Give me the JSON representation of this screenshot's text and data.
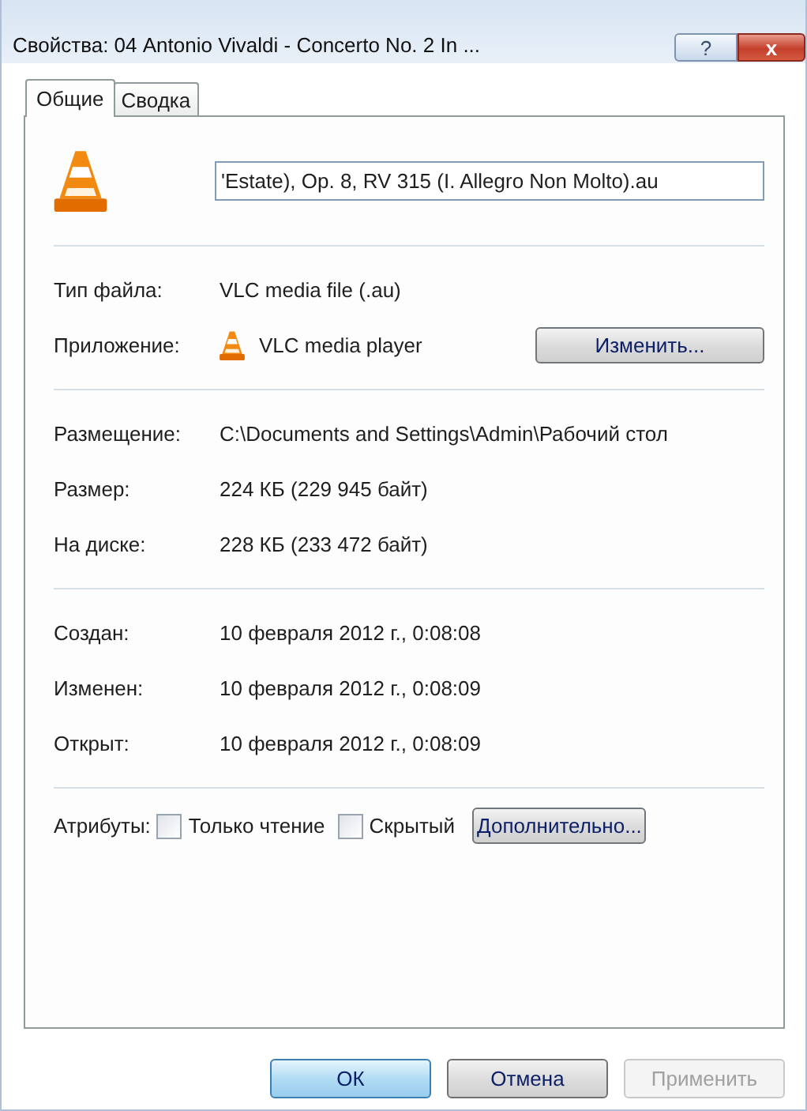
{
  "window": {
    "title": "Свойства: 04 Antonio Vivaldi - Concerto No. 2 In ...",
    "help_button": "?",
    "close_button": "x"
  },
  "tabs": [
    {
      "label": "Общие",
      "selected": true
    },
    {
      "label": "Сводка",
      "selected": false
    }
  ],
  "file_name": "'Estate), Op. 8, RV 315 (I. Allegro Non Molto).au",
  "sections": [
    [
      {
        "kind": "text",
        "label": "Тип файла:",
        "value": "VLC media file (.au)"
      },
      {
        "kind": "app",
        "label": "Приложение:",
        "value": "VLC media player",
        "button": "Изменить..."
      }
    ],
    [
      {
        "kind": "text",
        "label": "Размещение:",
        "value": "C:\\Documents and Settings\\Admin\\Рабочий стол"
      },
      {
        "kind": "text",
        "label": "Размер:",
        "value": "224 КБ (229 945 байт)"
      },
      {
        "kind": "text",
        "label": "На диске:",
        "value": "228 КБ (233 472 байт)"
      }
    ],
    [
      {
        "kind": "text",
        "label": "Создан:",
        "value": "10 февраля 2012 г., 0:08:08"
      },
      {
        "kind": "text",
        "label": "Изменен:",
        "value": "10 февраля 2012 г., 0:08:09"
      },
      {
        "kind": "text",
        "label": "Открыт:",
        "value": "10 февраля 2012 г., 0:08:09"
      }
    ]
  ],
  "attributes": {
    "label": "Атрибуты:",
    "checkboxes": [
      {
        "label": "Только чтение",
        "checked": false
      },
      {
        "label": "Скрытый",
        "checked": false
      }
    ],
    "button": "Дополнительно..."
  },
  "buttons": [
    {
      "label": "ОК",
      "kind": "default",
      "disabled": false
    },
    {
      "label": "Отмена",
      "kind": "normal",
      "disabled": false
    },
    {
      "label": "Применить",
      "kind": "normal",
      "disabled": true
    }
  ]
}
